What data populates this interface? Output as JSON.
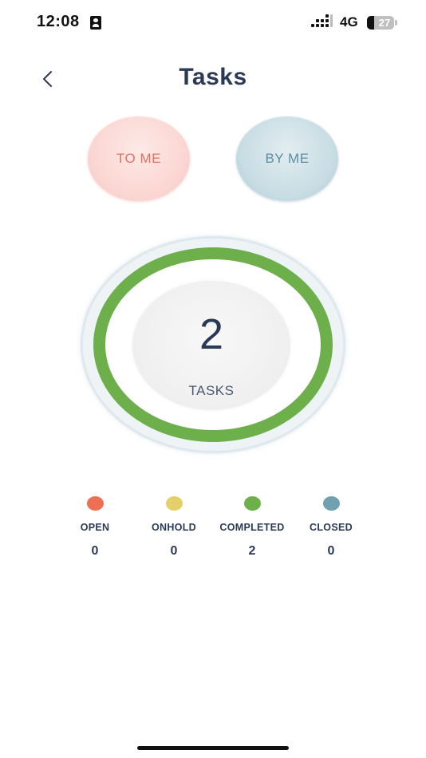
{
  "status_bar": {
    "time": "12:08",
    "network": "4G",
    "battery": "27"
  },
  "header": {
    "title": "Tasks"
  },
  "filters": {
    "to_me": "TO ME",
    "by_me": "BY ME"
  },
  "summary": {
    "count": "2",
    "label": "TASKS"
  },
  "statuses": [
    {
      "label": "OPEN",
      "value": "0",
      "color": "#ef6f55"
    },
    {
      "label": "ONHOLD",
      "value": "0",
      "color": "#e5cf6a"
    },
    {
      "label": "COMPLETED",
      "value": "2",
      "color": "#6db04b"
    },
    {
      "label": "CLOSED",
      "value": "0",
      "color": "#6fa1b1"
    }
  ],
  "colors": {
    "title": "#2a3a55",
    "ring": "#6db04b",
    "to_me_text": "#e0735e",
    "by_me_text": "#5b8ea2"
  }
}
